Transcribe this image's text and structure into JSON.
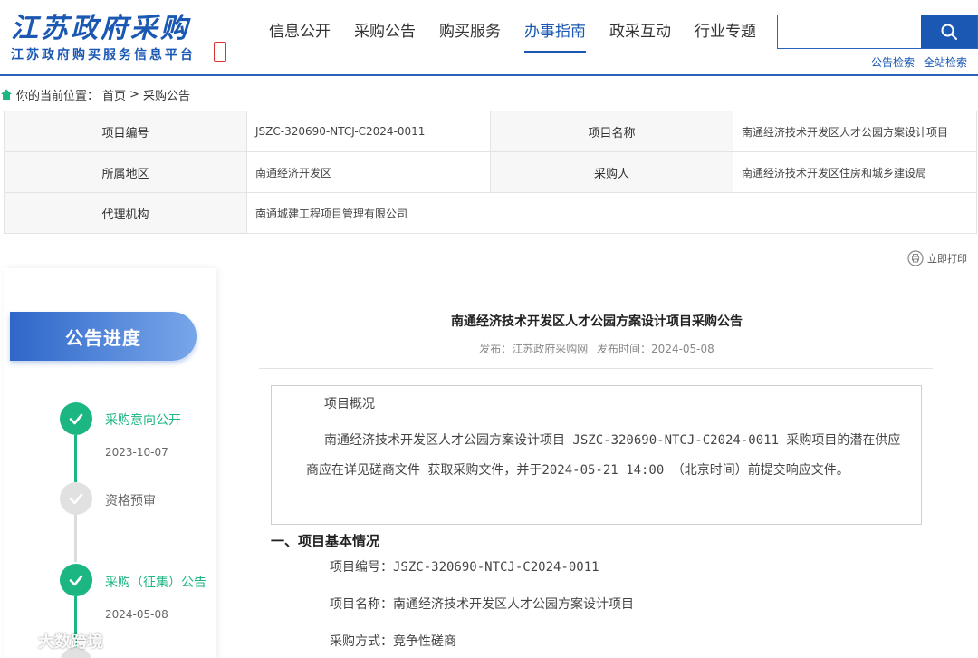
{
  "header": {
    "logo_title": "江苏政府采购",
    "logo_subtitle": "江苏政府购买服务信息平台",
    "nav": [
      {
        "label": "信息公开",
        "active": false
      },
      {
        "label": "采购公告",
        "active": false
      },
      {
        "label": "购买服务",
        "active": false
      },
      {
        "label": "办事指南",
        "active": true
      },
      {
        "label": "政采互动",
        "active": false
      },
      {
        "label": "行业专题",
        "active": false
      }
    ],
    "search_placeholder": "",
    "search_links": [
      "公告检索",
      "全站检索"
    ]
  },
  "breadcrumb": {
    "prefix": "你的当前位置：",
    "items": [
      "首页",
      ">",
      "采购公告"
    ]
  },
  "info": {
    "project_no_label": "项目编号",
    "project_no": "JSZC-320690-NTCJ-C2024-0011",
    "project_name_label": "项目名称",
    "project_name": "南通经济技术开发区人才公园方案设计项目",
    "region_label": "所属地区",
    "region": "南通经济开发区",
    "buyer_label": "采购人",
    "buyer": "南通经济技术开发区住房和城乡建设局",
    "agency_label": "代理机构",
    "agency": "南通城建工程项目管理有限公司"
  },
  "print_label": "立即打印",
  "sidebar": {
    "header": "公告进度",
    "steps": [
      {
        "label": "采购意向公开",
        "date": "2023-10-07",
        "status": "done"
      },
      {
        "label": "资格预审",
        "date": "",
        "status": "pending"
      },
      {
        "label": "采购（征集）公告",
        "date": "2024-05-08",
        "status": "done"
      }
    ]
  },
  "document": {
    "title": "南通经济技术开发区人才公园方案设计项目采购公告",
    "publisher": "发布：江苏政府采购网",
    "publish_time": "发布时间：2024-05-08",
    "summary_title": "项目概况",
    "summary_body": "南通经济技术开发区人才公园方案设计项目 JSZC-320690-NTCJ-C2024-0011 采购项目的潜在供应商应在详见磋商文件 获取采购文件，并于2024-05-21 14:00 （北京时间）前提交响应文件。",
    "section1_title": "一、项目基本情况",
    "field_project_no": "项目编号：JSZC-320690-NTCJ-C2024-0011",
    "field_project_name": "项目名称：南通经济技术开发区人才公园方案设计项目",
    "field_method": "采购方式：竞争性磋商"
  },
  "watermark": "大数跨境",
  "colors": {
    "brand_blue": "#1a58b3",
    "step_done": "#1bb681",
    "step_pending": "#e1e1e1"
  }
}
